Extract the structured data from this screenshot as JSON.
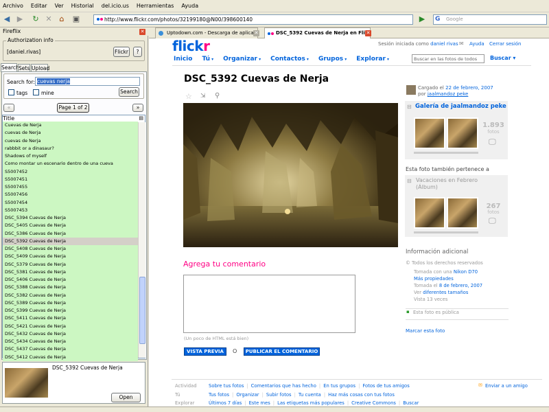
{
  "menu": [
    "Archivo",
    "Editar",
    "Ver",
    "Historial",
    "del.icio.us",
    "Herramientas",
    "Ayuda"
  ],
  "nav": {
    "url": "http://www.flickr.com/photos/32199180@N00/398600140",
    "search_placeholder": "Google"
  },
  "sidebar": {
    "title": "Fireflix",
    "auth_legend": "Authorization info",
    "user": "[daniel.rivas]",
    "flickr_btn": "Flickr",
    "help_btn": "?",
    "tabs": [
      "Search",
      "Sets",
      "Upload"
    ],
    "search_label": "Search for:",
    "search_value": "cuevas nerja",
    "tags_label": "tags",
    "mine_label": "mine",
    "search_btn": "Search",
    "page_label": "Page 1 of 2",
    "prev": "«",
    "next": "»",
    "col_title": "Title",
    "items": [
      "Cuevas de Nerja",
      "cuevas de Nerja",
      "cuevas de Nerja",
      "rabbbit or a dinasaur?",
      "Shadows of myself",
      "Como montar un escenario dentro de una cueva",
      "S5007452",
      "S5007451",
      "S5007455",
      "S5007456",
      "S5007454",
      "S5007453",
      "DSC_5394 Cuevas de Nerja",
      "DSC_5405 Cuevas de Nerja",
      "DSC_5386 Cuevas de Nerja",
      "DSC_5392 Cuevas de Nerja",
      "DSC_5408 Cuevas de Nerja",
      "DSC_5409 Cuevas de Nerja",
      "DSC_5379 Cuevas de Nerja",
      "DSC_5381 Cuevas de Nerja",
      "DSC_5406 Cuevas de Nerja",
      "DSC_5388 Cuevas de Nerja",
      "DSC_5382 Cuevas de Nerja",
      "DSC_5389 Cuevas de Nerja",
      "DSC_5399 Cuevas de Nerja",
      "DSC_5411 Cuevas de Nerja",
      "DSC_5421 Cuevas de Nerja",
      "DSC_5432 Cuevas de Nerja",
      "DSC_5434 Cuevas de Nerja",
      "DSC_5437 Cuevas de Nerja",
      "DSC_5412 Cuevas de Nerja"
    ],
    "selected_index": 15,
    "preview_title": "DSC_5392 Cuevas de Nerja",
    "open_btn": "Open"
  },
  "tabs": [
    {
      "label": "Uptodown.com - Descarga de aplicaci..."
    },
    {
      "label": "DSC_5392 Cuevas de Nerja en Fli..."
    }
  ],
  "flickr": {
    "logo_a": "flick",
    "logo_b": "r",
    "signed_in": "Sesión iniciada como",
    "username": "daniel rivas",
    "help": "Ayuda",
    "logout": "Cerrar sesión",
    "nav": [
      "Inicio",
      "Tú",
      "Organizar",
      "Contactos",
      "Grupos",
      "Explorar"
    ],
    "search_placeholder": "Buscar en las fotos de todos",
    "search_btn": "Buscar",
    "photo_title": "DSC_5392 Cuevas de Nerja",
    "uploaded_prefix": "Cargado el",
    "uploaded_date": "22 de febrero, 2007",
    "by_prefix": "por",
    "owner": "jaalmandoz peke",
    "gallery_title": "Galería de jaalmandoz peke",
    "gallery_count": "1.893",
    "gallery_unit": "fotos",
    "also_in": "Esta foto también pertenece a",
    "set_title": "Vacaciones en Febrero (Álbum)",
    "set_count": "267",
    "set_unit": "fotos",
    "comment_title": "Agrega tu comentario",
    "html_note": "(Un poco de HTML está bien)",
    "preview_btn": "VISTA PREVIA",
    "or": "O",
    "publish_btn": "PUBLICAR EL COMENTARIO",
    "info_title": "Información adicional",
    "rights": "Todos los derechos reservados",
    "camera_prefix": "Tomada con una",
    "camera": "Nikon D70",
    "more_props": "Más propiedades",
    "taken_prefix": "Tomada el",
    "taken_date": "8 de febrero, 2007",
    "sizes_prefix": "Ver",
    "sizes_link": "diferentes tamaños",
    "views": "Vista 13 veces",
    "public": "Esta foto es pública",
    "mark": "Marcar esta foto",
    "footer": [
      {
        "label": "Actividad",
        "links": [
          "Sobre tus fotos",
          "Comentarios que has hecho",
          "En tus grupos",
          "Fotos de tus amigos"
        ]
      },
      {
        "label": "Tú",
        "links": [
          "Tus fotos",
          "Organizar",
          "Subir fotos",
          "Tu cuenta",
          "Haz más cosas con tus fotos"
        ]
      },
      {
        "label": "Explorar",
        "links": [
          "Últimos 7 días",
          "Este mes",
          "Las etiquetas más populares",
          "Creative Commons",
          "Buscar"
        ]
      }
    ],
    "invite": "Enviar a un amigo"
  }
}
